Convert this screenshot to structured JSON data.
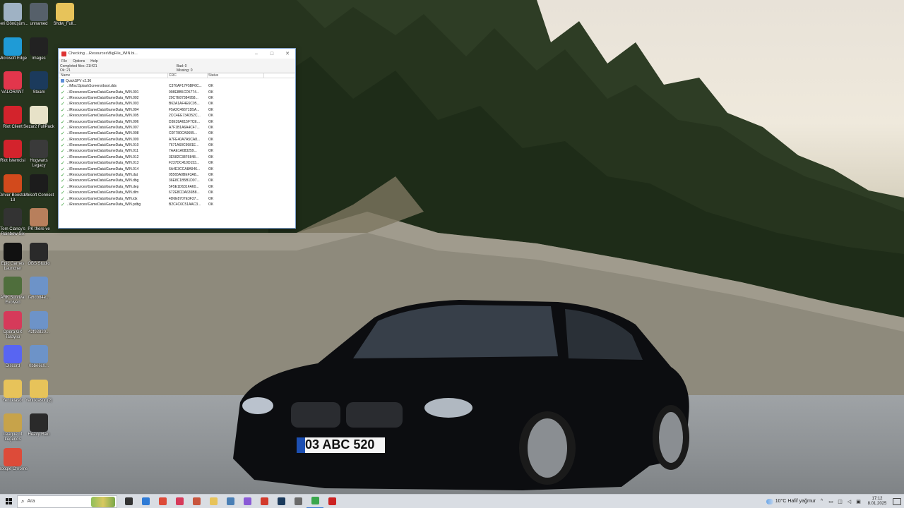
{
  "desktop_icons": [
    {
      "label": "Geri Dönüşüm...",
      "icon": "recycle-bin-icon",
      "color": "#9fb2c4"
    },
    {
      "label": "unnamed",
      "icon": "image-file-icon",
      "color": "#56606a"
    },
    {
      "label": "Shdw_Full...",
      "icon": "folder-icon",
      "color": "#e7c35a"
    },
    {
      "label": "Microsoft Edge",
      "icon": "edge-icon",
      "color": "#1f9bd6"
    },
    {
      "label": "images",
      "icon": "image-file-icon",
      "color": "#222222"
    },
    {
      "label": "VALORANT",
      "icon": "valorant-icon",
      "color": "#e2364c"
    },
    {
      "label": "Steam",
      "icon": "steam-icon",
      "color": "#1b3a5c"
    },
    {
      "label": "Riot Client",
      "icon": "riot-client-icon",
      "color": "#d3232c"
    },
    {
      "label": "Sezar2 FullPack",
      "icon": "file-icon",
      "color": "#e7e2c8"
    },
    {
      "label": "Riot İstemcisi",
      "icon": "riot-client-icon",
      "color": "#d3232c"
    },
    {
      "label": "Hogwarts Legacy",
      "icon": "hogwarts-legacy-icon",
      "color": "#3a3a3a"
    },
    {
      "label": "Driver Booster 13",
      "icon": "driver-booster-icon",
      "color": "#d24a1c"
    },
    {
      "label": "Ubisoft Connect",
      "icon": "ubisoft-icon",
      "color": "#1c1c1c"
    },
    {
      "label": "Tom Clancy's Rainbow Six",
      "icon": "rainbow-six-icon",
      "color": "#333333"
    },
    {
      "label": "PK there ve",
      "icon": "game-icon",
      "color": "#b87f5c"
    },
    {
      "label": "Epic Games Launcher",
      "icon": "epic-games-icon",
      "color": "#111111"
    },
    {
      "label": "OBS Studio",
      "icon": "obs-icon",
      "color": "#2a2a2a"
    },
    {
      "label": "ARK Survival Evolved",
      "icon": "ark-icon",
      "color": "#4f6e3c"
    },
    {
      "label": "fa6db84e...",
      "icon": "image-file-icon",
      "color": "#6d93c8"
    },
    {
      "label": "Opera GX Tarayıcı",
      "icon": "opera-gx-icon",
      "color": "#d63a5a"
    },
    {
      "label": "42f93820...",
      "icon": "image-file-icon",
      "color": "#6d93c8"
    },
    {
      "label": "Discord",
      "icon": "discord-icon",
      "color": "#5865f2"
    },
    {
      "label": "0bbe6c0...",
      "icon": "image-file-icon",
      "color": "#6d93c8"
    },
    {
      "label": "Yeni klasör",
      "icon": "folder-icon",
      "color": "#e7c35a"
    },
    {
      "label": "Yeni klasör (2)",
      "icon": "folder-icon",
      "color": "#e7c35a"
    },
    {
      "label": "League of Legends",
      "icon": "league-of-legends-icon",
      "color": "#c7a34a"
    },
    {
      "label": "Heavy Rain",
      "icon": "heavy-rain-icon",
      "color": "#2a2a2a"
    },
    {
      "label": "Google Chrome",
      "icon": "chrome-icon",
      "color": "#dd4b39"
    }
  ],
  "window": {
    "title": "Checking ...Resources\\BigFile_WIN.bi...",
    "menu": [
      "File",
      "Options",
      "Help"
    ],
    "stats": {
      "completed": "Completed files: 21/421",
      "bad": "Bad: 0",
      "ok": "Ok: 21",
      "missing": "Missing: 0"
    },
    "columns": [
      "Name",
      "CRC",
      "Status"
    ],
    "root": "QuickSFV v2.36",
    "rows": [
      {
        "name": "..\\Misc\\SplashScreens\\boot.dds",
        "crc": "C370AF17F5BF6C...",
        "status": "OK"
      },
      {
        "name": "..\\Resources\\GameData\\GameData_WIN.001",
        "crc": "998E8B5CD5774...",
        "status": "OK"
      },
      {
        "name": "..\\Resources\\GameData\\GameData_WIN.002",
        "crc": "29C7E87384958...",
        "status": "OK"
      },
      {
        "name": "..\\Resources\\GameData\\GameData_WIN.003",
        "crc": "B62A1AF4E6C05...",
        "status": "OK"
      },
      {
        "name": "..\\Resources\\GameData\\GameData_WIN.004",
        "crc": "F5A2C46671D5A...",
        "status": "OK"
      },
      {
        "name": "..\\Resources\\GameData\\GameData_WIN.005",
        "crc": "2CC4EE734D52C...",
        "status": "OK"
      },
      {
        "name": "..\\Resources\\GameData\\GameData_WIN.006",
        "crc": "D3E39A615F7CE...",
        "status": "OK"
      },
      {
        "name": "..\\Resources\\GameData\\GameData_WIN.007",
        "crc": "A7F1B1A6A4C47...",
        "status": "OK"
      },
      {
        "name": "..\\Resources\\GameData\\GameData_WIN.008",
        "crc": "C0F780CA9695...",
        "status": "OK"
      },
      {
        "name": "..\\Resources\\GameData\\GameData_WIN.009",
        "crc": "A7FE40A7A5CA8...",
        "status": "OK"
      },
      {
        "name": "..\\Resources\\GameData\\GameData_WIN.010",
        "crc": "7671A60C9981E...",
        "status": "OK"
      },
      {
        "name": "..\\Resources\\GameData\\GameData_WIN.011",
        "crc": "7AAE1A083259...",
        "status": "OK"
      },
      {
        "name": "..\\Resources\\GameData\\GameData_WIN.012",
        "crc": "3E582C38F6848...",
        "status": "OK"
      },
      {
        "name": "..\\Resources\\GameData\\GameData_WIN.013",
        "crc": "F237DC410D153...",
        "status": "OK"
      },
      {
        "name": "..\\Resources\\GameData\\GameData_WIN.014",
        "crc": "6A4E3CCA8A946...",
        "status": "OK"
      },
      {
        "name": "..\\Resources\\GameData\\GameData_WIN.dat",
        "crc": "05565A0BEF3A8...",
        "status": "OK"
      },
      {
        "name": "..\\Resources\\GameData\\GameData_WIN.dbg",
        "crc": "36E8C1B5B1D97...",
        "status": "OK"
      },
      {
        "name": "..\\Resources\\GameData\\GameData_WIN.dep",
        "crc": "5F5E1D631FA60...",
        "status": "OK"
      },
      {
        "name": "..\\Resources\\GameData\\GameData_WIN.dlm",
        "crc": "672E8CDA636B8...",
        "status": "OK"
      },
      {
        "name": "..\\Resources\\GameData\\GameData_WIN.idx",
        "crc": "4D6E8707E3F37...",
        "status": "OK"
      },
      {
        "name": "..\\Resources\\GameData\\GameData_WIN.pdbg",
        "crc": "B2C4C6C51AAC3...",
        "status": "OK"
      }
    ]
  },
  "taskbar": {
    "search_placeholder": "Ara",
    "apps": [
      {
        "icon": "task-view-icon",
        "color": "#333333"
      },
      {
        "icon": "store-icon",
        "color": "#2f7bd6"
      },
      {
        "icon": "chrome-icon",
        "color": "#dd4b39"
      },
      {
        "icon": "opera-gx-icon",
        "color": "#d63a5a"
      },
      {
        "icon": "paint-icon",
        "color": "#c8553d"
      },
      {
        "icon": "file-explorer-icon",
        "color": "#e7c35a"
      },
      {
        "icon": "calculator-icon",
        "color": "#4a7fb5"
      },
      {
        "icon": "photos-icon",
        "color": "#8a5ad6"
      },
      {
        "icon": "app-icon",
        "color": "#d33a2c"
      },
      {
        "icon": "steam-icon",
        "color": "#1b3a5c"
      },
      {
        "icon": "game-icon",
        "color": "#6a6a6a"
      },
      {
        "icon": "quicksfv-icon",
        "color": "#3aa64c"
      },
      {
        "icon": "media-icon",
        "color": "#c22"
      }
    ],
    "active_index": 11,
    "weather": "10°C Hafif yağmur",
    "time": "17:12",
    "date": "8.01.2025"
  },
  "car_plate": "03 ABC 520"
}
